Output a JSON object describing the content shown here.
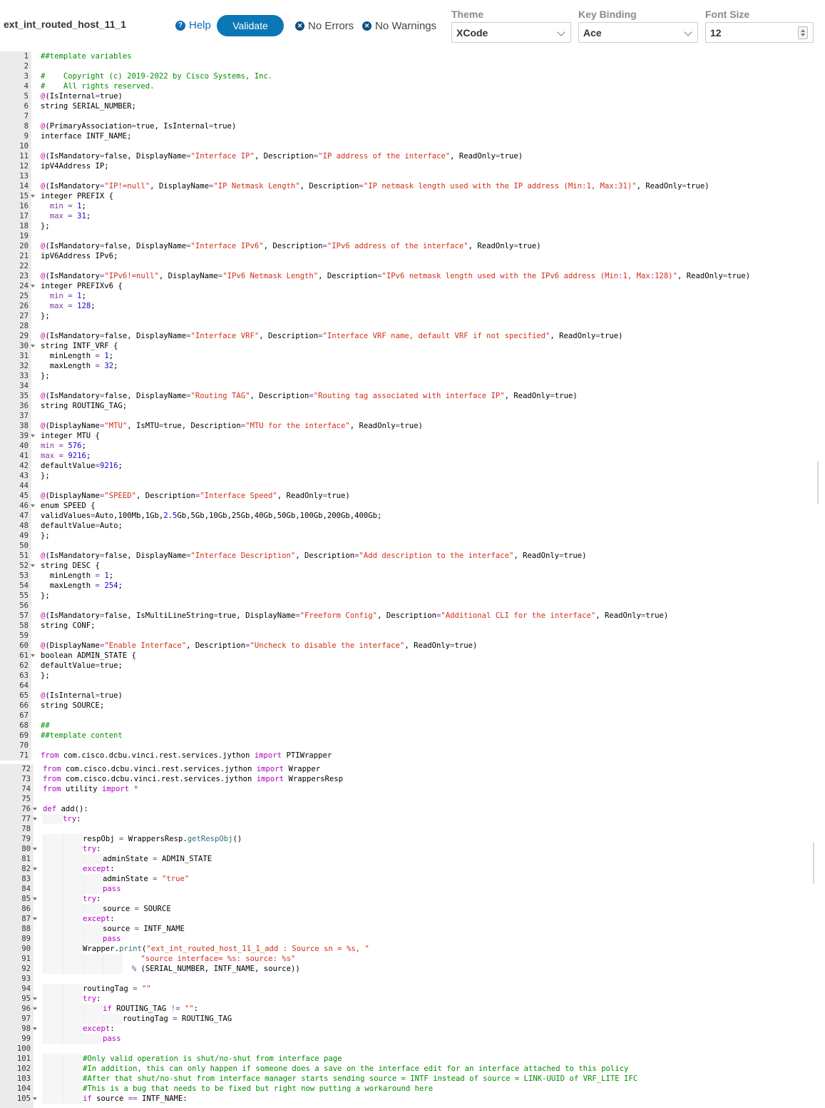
{
  "header": {
    "template_name": "ext_int_routed_host_11_1",
    "help_label": "Help",
    "validate_label": "Validate",
    "errors_label": "No Errors",
    "warnings_label": "No Warnings"
  },
  "settings": {
    "theme": {
      "label": "Theme",
      "value": "XCode"
    },
    "key_binding": {
      "label": "Key Binding",
      "value": "Ace"
    },
    "font_size": {
      "label": "Font Size",
      "value": "12"
    }
  },
  "editor1": {
    "lines": [
      {
        "n": "1",
        "fold": false,
        "html": "<span class='cm'>##template variables</span>"
      },
      {
        "n": "2",
        "fold": false,
        "html": ""
      },
      {
        "n": "3",
        "fold": false,
        "html": "<span class='cm'>#    Copyright (c) 2019-2022 by Cisco Systems, Inc.</span>"
      },
      {
        "n": "4",
        "fold": false,
        "html": "<span class='cm'>#    All rights reserved.</span>"
      },
      {
        "n": "5",
        "fold": false,
        "html": "<span class='at'>@</span>(IsInternal<span class='attr'>=</span>true)"
      },
      {
        "n": "6",
        "fold": false,
        "html": "string SERIAL_NUMBER;"
      },
      {
        "n": "7",
        "fold": false,
        "html": ""
      },
      {
        "n": "8",
        "fold": false,
        "html": "<span class='at'>@</span>(PrimaryAssociation<span class='attr'>=</span>true, IsInternal<span class='attr'>=</span>true)"
      },
      {
        "n": "9",
        "fold": false,
        "html": "interface INTF_NAME;"
      },
      {
        "n": "10",
        "fold": false,
        "html": ""
      },
      {
        "n": "11",
        "fold": false,
        "html": "<span class='at'>@</span>(IsMandatory<span class='attr'>=</span>false, DisplayName<span class='attr'>=</span><span class='str'>\"Interface IP\"</span>, Description<span class='attr'>=</span><span class='str'>\"IP address of the interface\"</span>, ReadOnly<span class='attr'>=</span>true)"
      },
      {
        "n": "12",
        "fold": false,
        "html": "ipV4Address IP;"
      },
      {
        "n": "13",
        "fold": false,
        "html": ""
      },
      {
        "n": "14",
        "fold": false,
        "html": "<span class='at'>@</span>(IsMandatory<span class='attr'>=</span><span class='str'>\"IP!=null\"</span>, DisplayName<span class='attr'>=</span><span class='str'>\"IP Netmask Length\"</span>, Description<span class='attr'>=</span><span class='str'>\"IP netmask length used with the IP address (Min:1, Max:31)\"</span>, ReadOnly<span class='attr'>=</span>true)"
      },
      {
        "n": "15",
        "fold": true,
        "html": "integer PREFIX {"
      },
      {
        "n": "16",
        "fold": false,
        "html": "  <span class='attr'>min</span> <span class='attr'>=</span> <span class='num'>1</span>;"
      },
      {
        "n": "17",
        "fold": false,
        "html": "  <span class='attr'>max</span> <span class='attr'>=</span> <span class='num'>31</span>;"
      },
      {
        "n": "18",
        "fold": false,
        "html": "};"
      },
      {
        "n": "19",
        "fold": false,
        "html": ""
      },
      {
        "n": "20",
        "fold": false,
        "html": "<span class='at'>@</span>(IsMandatory<span class='attr'>=</span>false, DisplayName<span class='attr'>=</span><span class='str'>\"Interface IPv6\"</span>, Description<span class='attr'>=</span><span class='str'>\"IPv6 address of the interface\"</span>, ReadOnly<span class='attr'>=</span>true)"
      },
      {
        "n": "21",
        "fold": false,
        "html": "ipV6Address IPv6;"
      },
      {
        "n": "22",
        "fold": false,
        "html": ""
      },
      {
        "n": "23",
        "fold": false,
        "html": "<span class='at'>@</span>(IsMandatory<span class='attr'>=</span><span class='str'>\"IPv6!=null\"</span>, DisplayName<span class='attr'>=</span><span class='str'>\"IPv6 Netmask Length\"</span>, Description<span class='attr'>=</span><span class='str'>\"IPv6 netmask length used with the IPv6 address (Min:1, Max:128)\"</span>, ReadOnly<span class='attr'>=</span>true)"
      },
      {
        "n": "24",
        "fold": true,
        "html": "integer PREFIXv6 {"
      },
      {
        "n": "25",
        "fold": false,
        "html": "  <span class='attr'>min</span> <span class='attr'>=</span> <span class='num'>1</span>;"
      },
      {
        "n": "26",
        "fold": false,
        "html": "  <span class='attr'>max</span> <span class='attr'>=</span> <span class='num'>128</span>;"
      },
      {
        "n": "27",
        "fold": false,
        "html": "};"
      },
      {
        "n": "28",
        "fold": false,
        "html": ""
      },
      {
        "n": "29",
        "fold": false,
        "html": "<span class='at'>@</span>(IsMandatory<span class='attr'>=</span>false, DisplayName<span class='attr'>=</span><span class='str'>\"Interface VRF\"</span>, Description<span class='attr'>=</span><span class='str'>\"Interface VRF name, default VRF if not specified\"</span>, ReadOnly<span class='attr'>=</span>true)"
      },
      {
        "n": "30",
        "fold": true,
        "html": "string INTF_VRF {"
      },
      {
        "n": "31",
        "fold": false,
        "html": "  minLength <span class='attr'>=</span> <span class='num'>1</span>;"
      },
      {
        "n": "32",
        "fold": false,
        "html": "  maxLength <span class='attr'>=</span> <span class='num'>32</span>;"
      },
      {
        "n": "33",
        "fold": false,
        "html": "};"
      },
      {
        "n": "34",
        "fold": false,
        "html": ""
      },
      {
        "n": "35",
        "fold": false,
        "html": "<span class='at'>@</span>(IsMandatory<span class='attr'>=</span>false, DisplayName<span class='attr'>=</span><span class='str'>\"Routing TAG\"</span>, Description<span class='attr'>=</span><span class='str'>\"Routing tag associated with interface IP\"</span>, ReadOnly<span class='attr'>=</span>true)"
      },
      {
        "n": "36",
        "fold": false,
        "html": "string ROUTING_TAG;"
      },
      {
        "n": "37",
        "fold": false,
        "html": ""
      },
      {
        "n": "38",
        "fold": false,
        "html": "<span class='at'>@</span>(DisplayName<span class='attr'>=</span><span class='str'>\"MTU\"</span>, IsMTU<span class='attr'>=</span>true, Description<span class='attr'>=</span><span class='str'>\"MTU for the interface\"</span>, ReadOnly<span class='attr'>=</span>true)"
      },
      {
        "n": "39",
        "fold": true,
        "html": "integer MTU {"
      },
      {
        "n": "40",
        "fold": false,
        "html": "<span class='attr'>min</span> <span class='attr'>=</span> <span class='num'>576</span>;"
      },
      {
        "n": "41",
        "fold": false,
        "html": "<span class='attr'>max</span> <span class='attr'>=</span> <span class='num'>9216</span>;"
      },
      {
        "n": "42",
        "fold": false,
        "html": "defaultValue<span class='attr'>=</span><span class='num'>9216</span>;"
      },
      {
        "n": "43",
        "fold": false,
        "html": "};"
      },
      {
        "n": "44",
        "fold": false,
        "html": ""
      },
      {
        "n": "45",
        "fold": false,
        "html": "<span class='at'>@</span>(DisplayName<span class='attr'>=</span><span class='str'>\"SPEED\"</span>, Description<span class='attr'>=</span><span class='str'>\"Interface Speed\"</span>, ReadOnly<span class='attr'>=</span>true)"
      },
      {
        "n": "46",
        "fold": true,
        "html": "enum SPEED {"
      },
      {
        "n": "47",
        "fold": false,
        "html": "validValues<span class='attr'>=</span>Auto,100Mb,1Gb,<span class='num'>2.5</span>Gb,5Gb,10Gb,25Gb,40Gb,50Gb,100Gb,200Gb,400Gb;"
      },
      {
        "n": "48",
        "fold": false,
        "html": "defaultValue<span class='attr'>=</span>Auto;"
      },
      {
        "n": "49",
        "fold": false,
        "html": "};"
      },
      {
        "n": "50",
        "fold": false,
        "html": ""
      },
      {
        "n": "51",
        "fold": false,
        "html": "<span class='at'>@</span>(IsMandatory<span class='attr'>=</span>false, DisplayName<span class='attr'>=</span><span class='str'>\"Interface Description\"</span>, Description<span class='attr'>=</span><span class='str'>\"Add description to the interface\"</span>, ReadOnly<span class='attr'>=</span>true)"
      },
      {
        "n": "52",
        "fold": true,
        "html": "string DESC {"
      },
      {
        "n": "53",
        "fold": false,
        "html": "  minLength <span class='attr'>=</span> <span class='num'>1</span>;"
      },
      {
        "n": "54",
        "fold": false,
        "html": "  maxLength <span class='attr'>=</span> <span class='num'>254</span>;"
      },
      {
        "n": "55",
        "fold": false,
        "html": "};"
      },
      {
        "n": "56",
        "fold": false,
        "html": ""
      },
      {
        "n": "57",
        "fold": false,
        "html": "<span class='at'>@</span>(IsMandatory<span class='attr'>=</span>false, IsMultiLineString<span class='attr'>=</span>true, DisplayName<span class='attr'>=</span><span class='str'>\"Freeform Config\"</span>, Description<span class='attr'>=</span><span class='str'>\"Additional CLI for the interface\"</span>, ReadOnly<span class='attr'>=</span>true)"
      },
      {
        "n": "58",
        "fold": false,
        "html": "string CONF;"
      },
      {
        "n": "59",
        "fold": false,
        "html": ""
      },
      {
        "n": "60",
        "fold": false,
        "html": "<span class='at'>@</span>(DisplayName<span class='attr'>=</span><span class='str'>\"Enable Interface\"</span>, Description<span class='attr'>=</span><span class='str'>\"Uncheck to disable the interface\"</span>, ReadOnly<span class='attr'>=</span>true)"
      },
      {
        "n": "61",
        "fold": true,
        "html": "boolean ADMIN_STATE {"
      },
      {
        "n": "62",
        "fold": false,
        "html": "defaultValue<span class='attr'>=</span>true;"
      },
      {
        "n": "63",
        "fold": false,
        "html": "};"
      },
      {
        "n": "64",
        "fold": false,
        "html": ""
      },
      {
        "n": "65",
        "fold": false,
        "html": "<span class='at'>@</span>(IsInternal<span class='attr'>=</span>true)"
      },
      {
        "n": "66",
        "fold": false,
        "html": "string SOURCE;"
      },
      {
        "n": "67",
        "fold": false,
        "html": ""
      },
      {
        "n": "68",
        "fold": false,
        "html": "<span class='cm'>##</span>"
      },
      {
        "n": "69",
        "fold": false,
        "html": "<span class='cm'>##template content</span>"
      },
      {
        "n": "70",
        "fold": false,
        "html": ""
      },
      {
        "n": "71",
        "fold": false,
        "html": "<span class='kw'>from</span> com.cisco.dcbu.vinci.rest.services.jython <span class='kw'>import</span> PTIWrapper"
      }
    ]
  },
  "editor2": {
    "lines": [
      {
        "n": "72",
        "fold": false,
        "ind": 0,
        "html": "<span class='kw'>from</span> com.cisco.dcbu.vinci.rest.services.jython <span class='kw'>import</span> Wrapper"
      },
      {
        "n": "73",
        "fold": false,
        "ind": 0,
        "html": "<span class='kw'>from</span> com.cisco.dcbu.vinci.rest.services.jython <span class='kw'>import</span> WrappersResp"
      },
      {
        "n": "74",
        "fold": false,
        "ind": 0,
        "html": "<span class='kw'>from</span> utility <span class='kw'>import</span> <span class='attr'>*</span>"
      },
      {
        "n": "75",
        "fold": false,
        "ind": 0,
        "html": ""
      },
      {
        "n": "76",
        "fold": true,
        "ind": 0,
        "html": "<span class='kw'>def</span> add():"
      },
      {
        "n": "77",
        "fold": true,
        "ind": 1,
        "html": "<span class='kw'>try</span>:"
      },
      {
        "n": "78",
        "fold": false,
        "ind": 0,
        "html": ""
      },
      {
        "n": "79",
        "fold": false,
        "ind": 2,
        "html": "respObj <span class='attr'>=</span> WrappersResp.<span class='fn'>getRespObj</span>()"
      },
      {
        "n": "80",
        "fold": true,
        "ind": 2,
        "html": "<span class='kw'>try</span>:"
      },
      {
        "n": "81",
        "fold": false,
        "ind": 3,
        "html": "adminState <span class='attr'>=</span> ADMIN_STATE"
      },
      {
        "n": "82",
        "fold": true,
        "ind": 2,
        "html": "<span class='kw'>except</span>:"
      },
      {
        "n": "83",
        "fold": false,
        "ind": 3,
        "html": "adminState <span class='attr'>=</span> <span class='str'>\"true\"</span>"
      },
      {
        "n": "84",
        "fold": false,
        "ind": 3,
        "html": "<span class='kw'>pass</span>"
      },
      {
        "n": "85",
        "fold": true,
        "ind": 2,
        "html": "<span class='kw'>try</span>:"
      },
      {
        "n": "86",
        "fold": false,
        "ind": 3,
        "html": "source <span class='attr'>=</span> SOURCE"
      },
      {
        "n": "87",
        "fold": true,
        "ind": 2,
        "html": "<span class='kw'>except</span>:"
      },
      {
        "n": "88",
        "fold": false,
        "ind": 3,
        "html": "source <span class='attr'>=</span> INTF_NAME"
      },
      {
        "n": "89",
        "fold": false,
        "ind": 3,
        "html": "<span class='kw'>pass</span>"
      },
      {
        "n": "90",
        "fold": false,
        "ind": 2,
        "html": "Wrapper.<span class='fn'>print</span>(<span class='str'>\"ext_int_routed_host_11_1_add : Source sn = %s, \"</span>"
      },
      {
        "n": "91",
        "fold": false,
        "ind": 4,
        "html": "    <span class='str'>\"source interface= %s: source: %s\"</span>"
      },
      {
        "n": "92",
        "fold": false,
        "ind": 4,
        "html": "  <span class='attr'>%</span> (SERIAL_NUMBER, INTF_NAME, source))"
      },
      {
        "n": "93",
        "fold": false,
        "ind": 0,
        "html": ""
      },
      {
        "n": "94",
        "fold": false,
        "ind": 2,
        "html": "routingTag <span class='attr'>=</span> <span class='str'>\"\"</span>"
      },
      {
        "n": "95",
        "fold": true,
        "ind": 2,
        "html": "<span class='kw'>try</span>:"
      },
      {
        "n": "96",
        "fold": true,
        "ind": 3,
        "html": "<span class='kw'>if</span> ROUTING_TAG <span class='attr'>!=</span> <span class='str'>\"\"</span>:"
      },
      {
        "n": "97",
        "fold": false,
        "ind": 4,
        "html": "routingTag <span class='attr'>=</span> ROUTING_TAG"
      },
      {
        "n": "98",
        "fold": true,
        "ind": 2,
        "html": "<span class='kw'>except</span>:"
      },
      {
        "n": "99",
        "fold": false,
        "ind": 3,
        "html": "<span class='kw'>pass</span>"
      },
      {
        "n": "100",
        "fold": false,
        "ind": 0,
        "html": ""
      },
      {
        "n": "101",
        "fold": false,
        "ind": 2,
        "html": "<span class='cm'>#Only valid operation is shut/no-shut from interface page</span>"
      },
      {
        "n": "102",
        "fold": false,
        "ind": 2,
        "html": "<span class='cm'>#In addition, this can only happen if someone does a save on the interface edit for an interface attached to this policy</span>"
      },
      {
        "n": "103",
        "fold": false,
        "ind": 2,
        "html": "<span class='cm'>#After that shut/no-shut from interface manager starts sending source = INTF instead of source = LINK-UUID of VRF_LITE IFC</span>"
      },
      {
        "n": "104",
        "fold": false,
        "ind": 2,
        "html": "<span class='cm'>#This is a bug that needs to be fixed but right now putting a workaround here</span>"
      },
      {
        "n": "105",
        "fold": true,
        "ind": 2,
        "html": "<span class='kw'>if</span> source <span class='attr'>==</span> INTF_NAME:"
      }
    ]
  }
}
